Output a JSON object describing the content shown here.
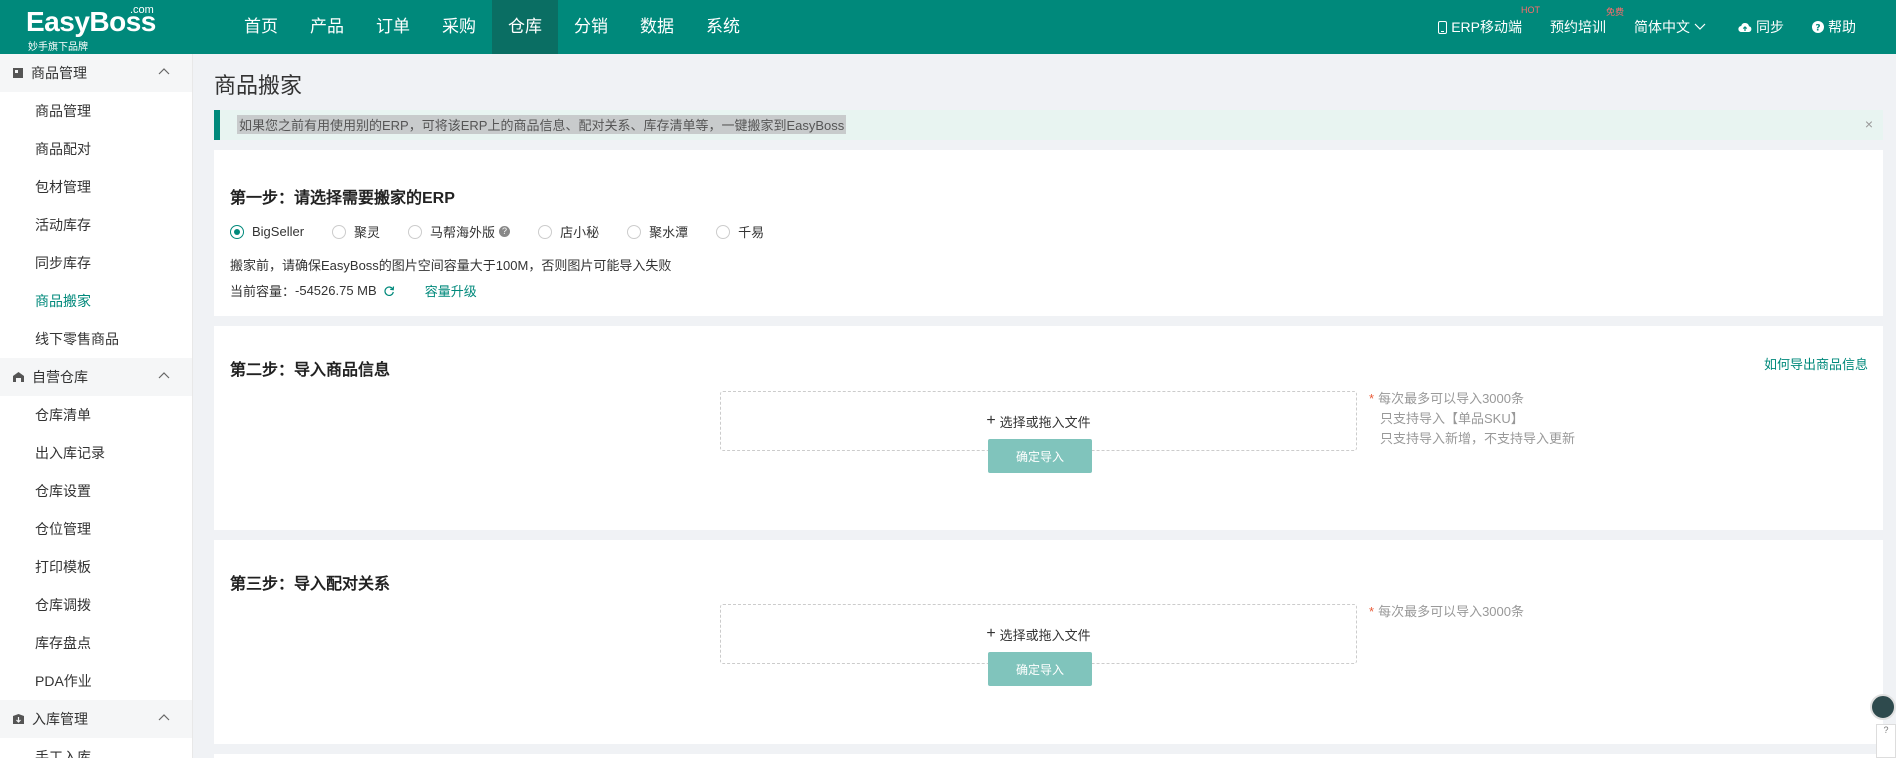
{
  "brand": {
    "name": "EasyBoss",
    "com": ".com",
    "sub": "妙手旗下品牌"
  },
  "nav": [
    {
      "label": "首页"
    },
    {
      "label": "产品"
    },
    {
      "label": "订单"
    },
    {
      "label": "采购"
    },
    {
      "label": "仓库",
      "active": true
    },
    {
      "label": "分销"
    },
    {
      "label": "数据"
    },
    {
      "label": "系统"
    }
  ],
  "top_right": {
    "mobile": "ERP移动端",
    "mobile_badge": "HOT",
    "training": "预约培训",
    "training_badge": "免费",
    "language": "简体中文",
    "sync": "同步",
    "help": "帮助"
  },
  "sidebar": {
    "groups": [
      {
        "title": "商品管理",
        "icon": "product-icon",
        "items": [
          "商品管理",
          "商品配对",
          "包材管理",
          "活动库存",
          "同步库存",
          "商品搬家",
          "线下零售商品"
        ]
      },
      {
        "title": "自营仓库",
        "icon": "warehouse-icon",
        "items": [
          "仓库清单",
          "出入库记录",
          "仓库设置",
          "仓位管理",
          "打印模板",
          "仓库调拨",
          "库存盘点",
          "PDA作业"
        ]
      },
      {
        "title": "入库管理",
        "icon": "inbound-icon",
        "items": [
          "手工入库"
        ]
      }
    ],
    "active_item": "商品搬家"
  },
  "page": {
    "title": "商品搬家",
    "notice": "如果您之前有用使用别的ERP，可将该ERP上的商品信息、配对关系、库存清单等，一键搬家到EasyBoss",
    "notice_close": "×"
  },
  "step1": {
    "title": "第一步：请选择需要搬家的ERP",
    "options": [
      {
        "label": "BigSeller",
        "checked": true
      },
      {
        "label": "聚灵"
      },
      {
        "label": "马帮海外版",
        "help": true
      },
      {
        "label": "店小秘"
      },
      {
        "label": "聚水潭"
      },
      {
        "label": "千易"
      }
    ],
    "warning": "搬家前，请确保EasyBoss的图片空间容量大于100M，否则图片可能导入失败",
    "capacity_label": "当前容量：",
    "capacity_value": "-54526.75 MB",
    "upgrade": "容量升级"
  },
  "step2": {
    "title": "第二步：导入商品信息",
    "link": "如何导出商品信息",
    "dropzone": "选择或拖入文件",
    "button": "确定导入",
    "tips": [
      "每次最多可以导入3000条",
      "只支持导入【单品SKU】",
      "只支持导入新增，不支持导入更新"
    ]
  },
  "step3": {
    "title": "第三步：导入配对关系",
    "dropzone": "选择或拖入文件",
    "button": "确定导入",
    "tips": [
      "每次最多可以导入3000条"
    ]
  },
  "colors": {
    "primary": "#00897b",
    "nav_active": "#0a6e63",
    "button_disabled": "#80c4bc",
    "required_star": "#e95c39"
  }
}
